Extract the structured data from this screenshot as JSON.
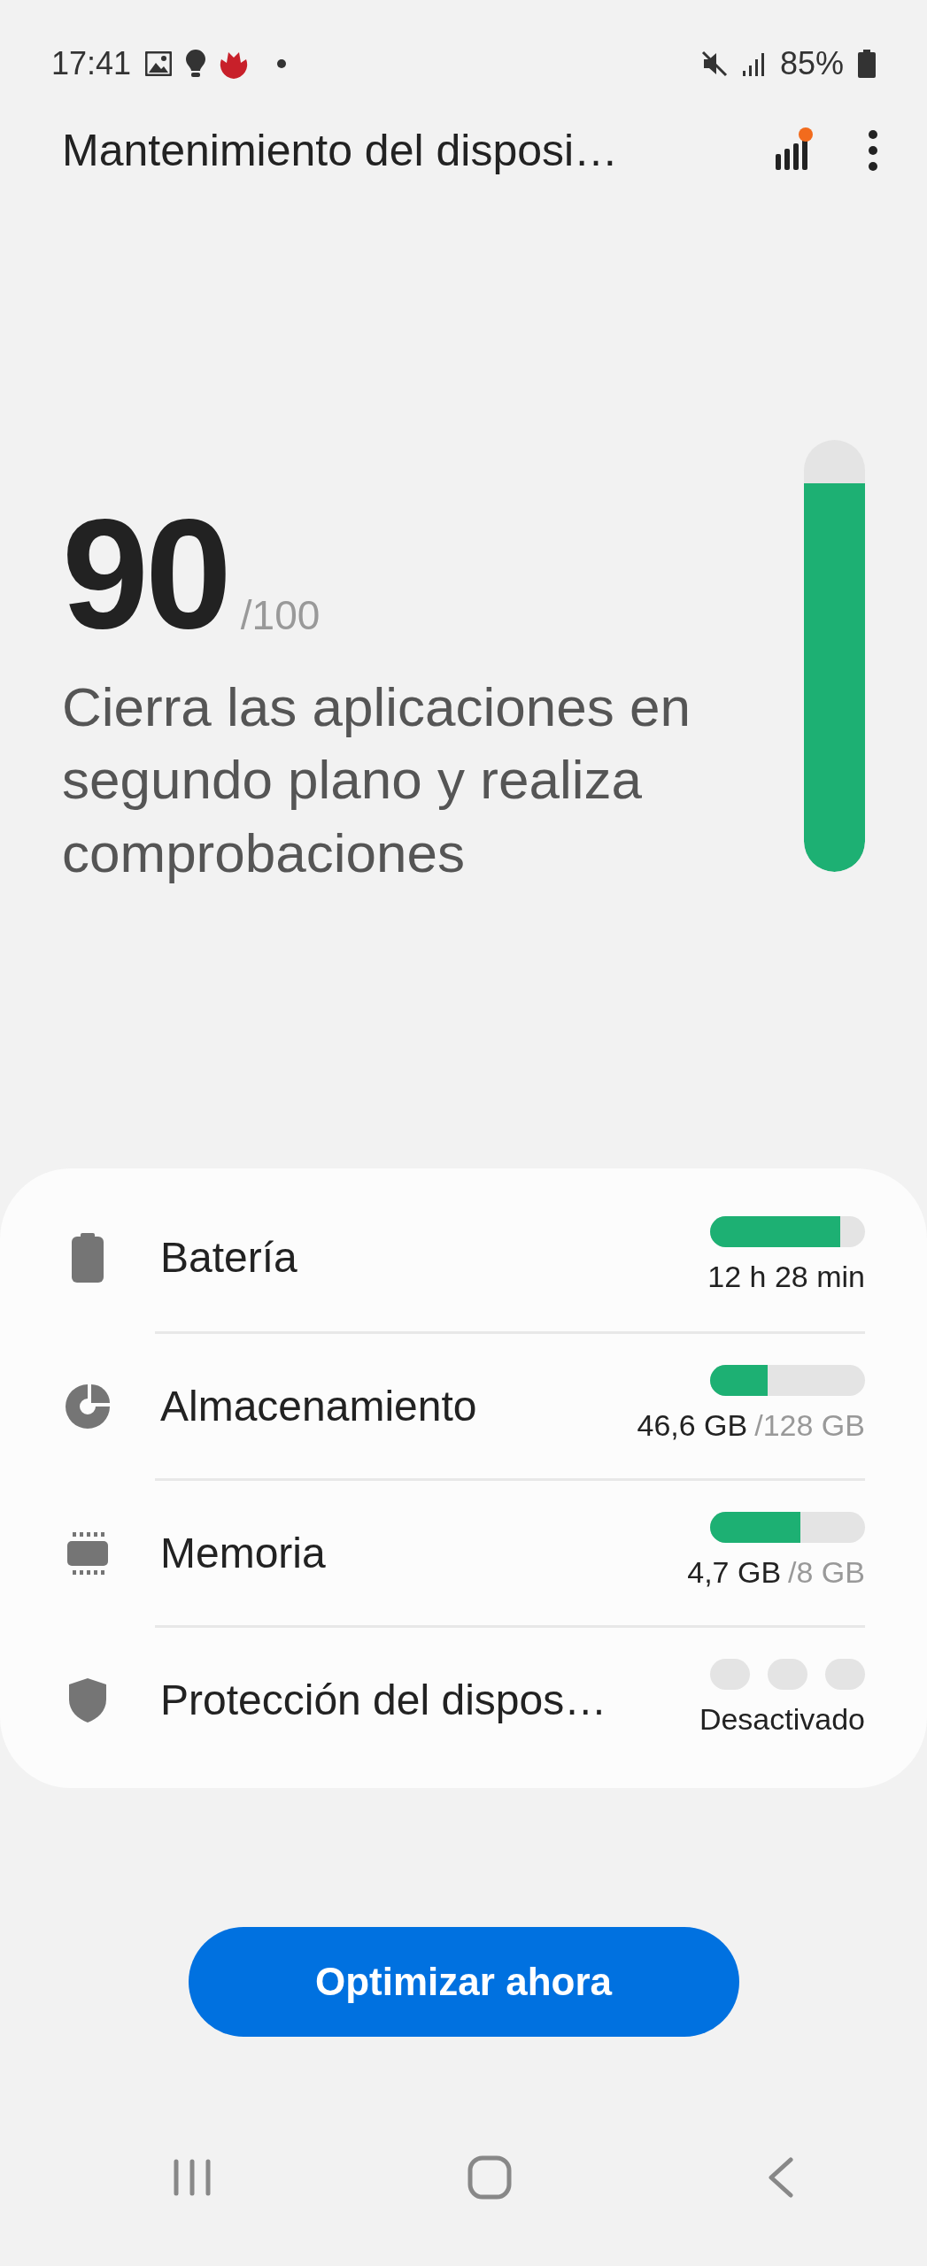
{
  "status_bar": {
    "time": "17:41",
    "battery": "85%"
  },
  "app_bar": {
    "title": "Mantenimiento del disposi…",
    "has_notification": true
  },
  "score": {
    "value": "90",
    "max": "/100",
    "message": "Cierra las aplicaciones en segundo plano y realiza comprobaciones",
    "level": 0.9
  },
  "items": [
    {
      "kind": "bar",
      "label": "Batería",
      "level": 0.84,
      "value": "12 h 28 min"
    },
    {
      "kind": "bar",
      "label": "Almacenamiento",
      "level": 0.37,
      "value": "46,6 GB",
      "total": "/128 GB"
    },
    {
      "kind": "bar",
      "label": "Memoria",
      "level": 0.58,
      "value": "4,7 GB",
      "total": "/8 GB"
    },
    {
      "kind": "segments",
      "label": "Protección del dispos…",
      "segments": [
        {
          "on": false
        },
        {
          "on": false
        },
        {
          "on": false
        }
      ],
      "value": "Desactivado"
    }
  ],
  "button": "Optimizar ahora"
}
